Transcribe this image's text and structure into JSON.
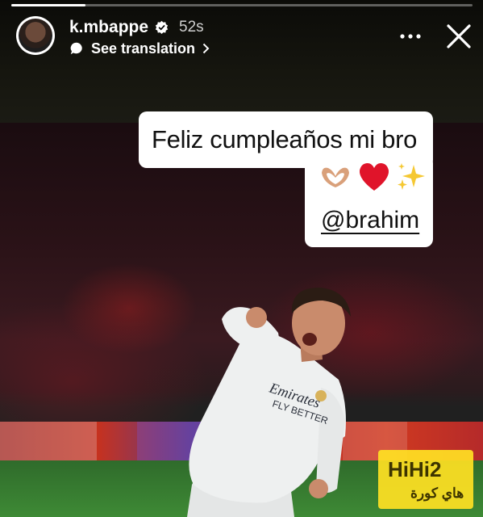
{
  "story": {
    "progress_fraction": 0.16,
    "username": "k.mbappe",
    "verified": true,
    "time_ago": "52s",
    "translate_label": "See translation"
  },
  "caption": {
    "text": "Feliz cumpleaños mi bro",
    "emojis": [
      "heart-hands",
      "red-heart",
      "sparkles"
    ],
    "mention": "@brahim"
  },
  "watermark": {
    "brand": "HiHi2",
    "tagline": "هاي كورة",
    "color": "#ffe123"
  },
  "jersey": {
    "sponsor_line1": "Emirates",
    "sponsor_line2": "FLY BETTER"
  },
  "colors": {
    "jersey": "#eef0f0",
    "boards_red": "#c7321e",
    "pitch_green": "#3e8a35"
  }
}
